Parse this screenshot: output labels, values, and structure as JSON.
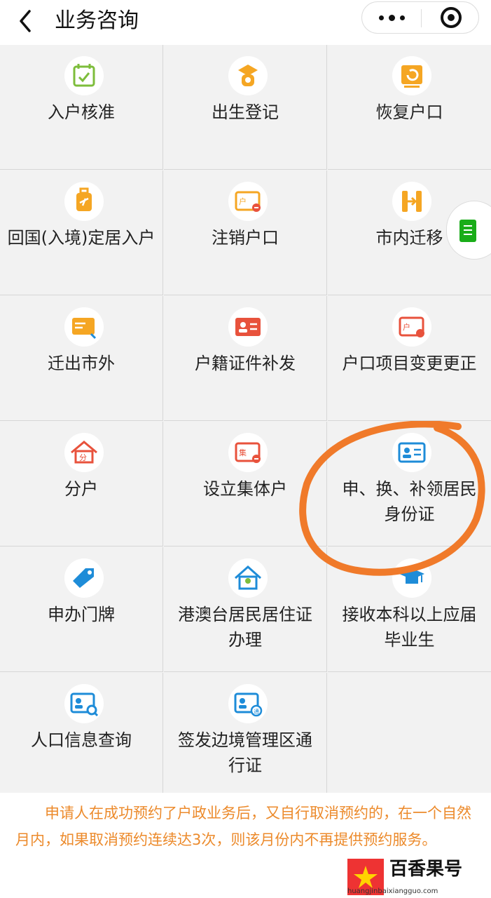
{
  "header": {
    "back_icon": "chevron-left-icon",
    "title": "业务咨询",
    "more_icon": "more-dots-icon",
    "close_icon": "close-circle-icon"
  },
  "colors": {
    "orange": "#F5A623",
    "red": "#E8523C",
    "blue": "#1E8CD8",
    "notice": "#EC8A2B",
    "highlight": "#F07A2A"
  },
  "services": [
    {
      "label": "入户核准",
      "icon": "calendar-check-icon"
    },
    {
      "label": "出生登记",
      "icon": "baby-icon"
    },
    {
      "label": "恢复户口",
      "icon": "restore-icon"
    },
    {
      "label": "回国(入境)定居入户",
      "icon": "luggage-icon"
    },
    {
      "label": "注销户口",
      "icon": "hukou-card-minus-icon"
    },
    {
      "label": "市内迁移",
      "icon": "move-arrow-icon"
    },
    {
      "label": "迁出市外",
      "icon": "card-out-icon"
    },
    {
      "label": "户籍证件补发",
      "icon": "id-card-icon"
    },
    {
      "label": "户口项目变更更正",
      "icon": "hukou-card-edit-icon"
    },
    {
      "label": "分户",
      "icon": "house-split-icon"
    },
    {
      "label": "设立集体户",
      "icon": "collective-card-icon"
    },
    {
      "label": "申、换、补领居民身份证",
      "icon": "identity-card-icon"
    },
    {
      "label": "申办门牌",
      "icon": "tag-icon"
    },
    {
      "label": "港澳台居民居住证办理",
      "icon": "residence-house-icon"
    },
    {
      "label": "接收本科以上应届毕业生",
      "icon": "graduate-cap-icon"
    },
    {
      "label": "人口信息查询",
      "icon": "id-search-icon"
    },
    {
      "label": "签发边境管理区通行证",
      "icon": "border-pass-icon"
    }
  ],
  "notice": "申请人在成功预约了户政业务后，又自行取消预约的，在一个自然月内，如果取消预约连续达3次，则该月份内不再提供预约服务。",
  "floating": {
    "icon": "document-icon"
  },
  "watermark": {
    "name": "百香果号",
    "url": "huangjinbaixiangguo.com"
  }
}
